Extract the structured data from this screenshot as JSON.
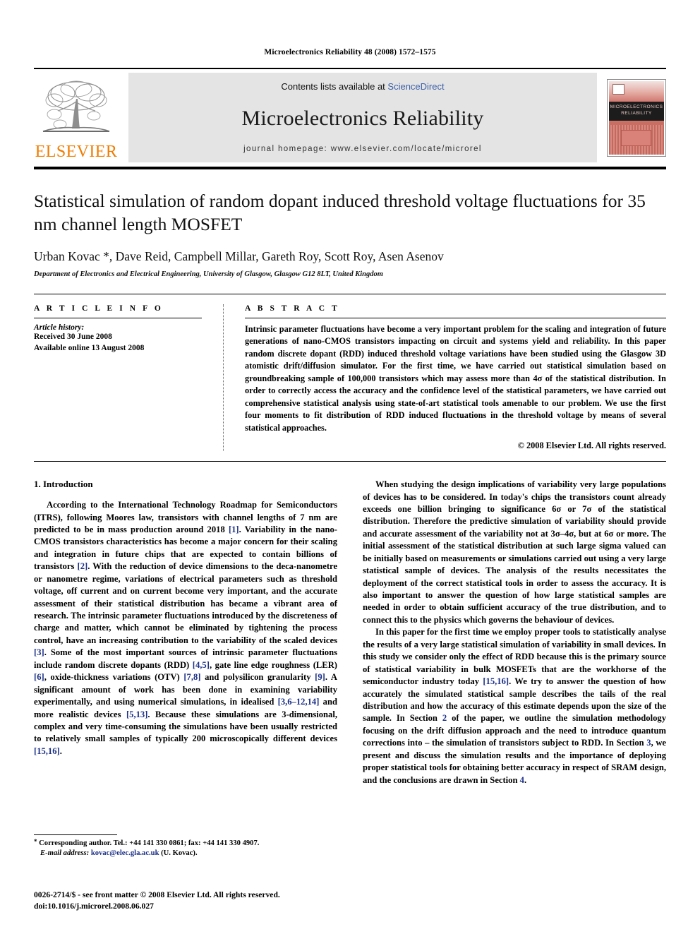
{
  "running_head": "Microelectronics Reliability 48 (2008) 1572–1575",
  "masthead": {
    "publisher_name": "ELSEVIER",
    "contents_prefix": "Contents lists available at ",
    "contents_link": "ScienceDirect",
    "journal_title": "Microelectronics Reliability",
    "homepage": "journal homepage: www.elsevier.com/locate/microrel",
    "cover_line1": "MICROELECTRONICS",
    "cover_line2": "RELIABILITY",
    "link_color": "#3b5fa8",
    "brand_color": "#f07c00"
  },
  "title": "Statistical simulation of random dopant induced threshold voltage fluctuations for 35 nm channel length MOSFET",
  "authors": "Urban Kovac *, Dave Reid, Campbell Millar, Gareth Roy, Scott Roy, Asen Asenov",
  "affiliation": "Department of Electronics and Electrical Engineering, University of Glasgow, Glasgow G12 8LT, United Kingdom",
  "article_info": {
    "heading": "A R T I C L E   I N F O",
    "history_label": "Article history:",
    "received": "Received 30 June 2008",
    "available": "Available online 13 August 2008"
  },
  "abstract": {
    "heading": "A B S T R A C T",
    "text": "Intrinsic parameter fluctuations have become a very important problem for the scaling and integration of future generations of nano-CMOS transistors impacting on circuit and systems yield and reliability. In this paper random discrete dopant (RDD) induced threshold voltage variations have been studied using the Glasgow 3D atomistic drift/diffusion simulator. For the first time, we have carried out statistical simulation based on groundbreaking sample of 100,000 transistors which may assess more than 4σ of the statistical distribution. In order to correctly access the accuracy and the confidence level of the statistical parameters, we have carried out comprehensive statistical analysis using state-of-art statistical tools amenable to our problem. We use the first four moments to fit distribution of RDD induced fluctuations in the threshold voltage by means of several statistical approaches.",
    "copyright": "© 2008 Elsevier Ltd. All rights reserved."
  },
  "section1": {
    "title": "1. Introduction",
    "left_p1_a": "According to the International Technology Roadmap for Semiconductors (ITRS), following Moores law, transistors with channel lengths of 7 nm are predicted to be in mass production around 2018 ",
    "left_p1_r1": "[1]",
    "left_p1_b": ". Variability in the nano-CMOS transistors characteristics has become a major concern for their scaling and integration in future chips that are expected to contain billions of transistors ",
    "left_p1_r2": "[2]",
    "left_p1_c": ". With the reduction of device dimensions to the deca-nanometre or nanometre regime, variations of electrical parameters such as threshold voltage, off current and on current become very important, and the accurate assessment of their statistical distribution has became a vibrant area of research. The intrinsic parameter fluctuations introduced by the discreteness of charge and matter, which cannot be eliminated by tightening the process control, have an increasing contribution to the variability of the scaled devices ",
    "left_p1_r3": "[3]",
    "left_p1_d": ". Some of the most important sources of intrinsic parameter fluctuations include random discrete dopants (RDD) ",
    "left_p1_r4": "[4,5]",
    "left_p1_e": ", gate line edge roughness (LER) ",
    "left_p1_r5": "[6]",
    "left_p1_f": ", oxide-thickness variations (OTV) ",
    "left_p1_r6": "[7,8]",
    "left_p1_g": " and polysilicon granularity ",
    "left_p1_r7": "[9]",
    "left_p1_h": ". A significant amount of work has been done in examining variability experimentally, and using numerical simulations, in idealised ",
    "left_p1_r8": "[3,6–12,14]",
    "left_p1_i": " and more realistic devices ",
    "left_p1_r9": "[5,13]",
    "left_p1_j": ". Because these simulations are 3-dimensional, complex and very time-consuming the simulations have been usually restricted to relatively small samples of typically 200 microscopically different devices ",
    "left_p1_r10": "[15,16]",
    "left_p1_k": ".",
    "right_p1_a": "When studying the design implications of variability very large populations of devices has to be considered. In today's chips the transistors count already exceeds one billion bringing to significance 6σ or 7σ of the statistical distribution. Therefore the predictive simulation of variability should provide and accurate assessment of the variability not at 3σ–4σ, but at 6σ or more. The initial assessment of the statistical distribution at such large sigma valued can be initially based on measurements or simulations carried out using a very large statistical sample of devices. The analysis of the results necessitates the deployment of the correct statistical tools in order to assess the accuracy. It is also important to answer the question of how large statistical samples are needed in order to obtain sufficient accuracy of the true distribution, and to connect this to the physics which governs the behaviour of devices.",
    "right_p2_a": "In this paper for the first time we employ proper tools to statistically analyse the results of a very large statistical simulation of variability in small devices. In this study we consider only the effect of RDD because this is the primary source of statistical variability in bulk MOSFETs that are the workhorse of the semiconductor industry today ",
    "right_p2_r1": "[15,16]",
    "right_p2_b": ". We try to answer the question of how accurately the simulated statistical sample describes the tails of the real distribution and how the accuracy of this estimate depends upon the size of the sample. In Section ",
    "right_p2_r2": "2",
    "right_p2_c": " of the paper, we outline the simulation methodology focusing on the drift diffusion approach and the need to introduce quantum corrections into – the simulation of transistors subject to RDD. In Section ",
    "right_p2_r3": "3",
    "right_p2_d": ", we present and discuss the simulation results and the importance of deploying proper statistical tools for obtaining better accuracy in respect of SRAM design, and the conclusions are drawn in Section ",
    "right_p2_r4": "4",
    "right_p2_e": "."
  },
  "footnote": {
    "star": "*",
    "corresponding": " Corresponding author. Tel.: +44 141 330 0861; fax: +44 141 330 4907.",
    "email_label": "E-mail address:",
    "email": "kovac@elec.gla.ac.uk",
    "email_suffix": " (U. Kovac)."
  },
  "issn_line1": "0026-2714/$ - see front matter © 2008 Elsevier Ltd. All rights reserved.",
  "issn_line2": "doi:10.1016/j.microrel.2008.06.027"
}
